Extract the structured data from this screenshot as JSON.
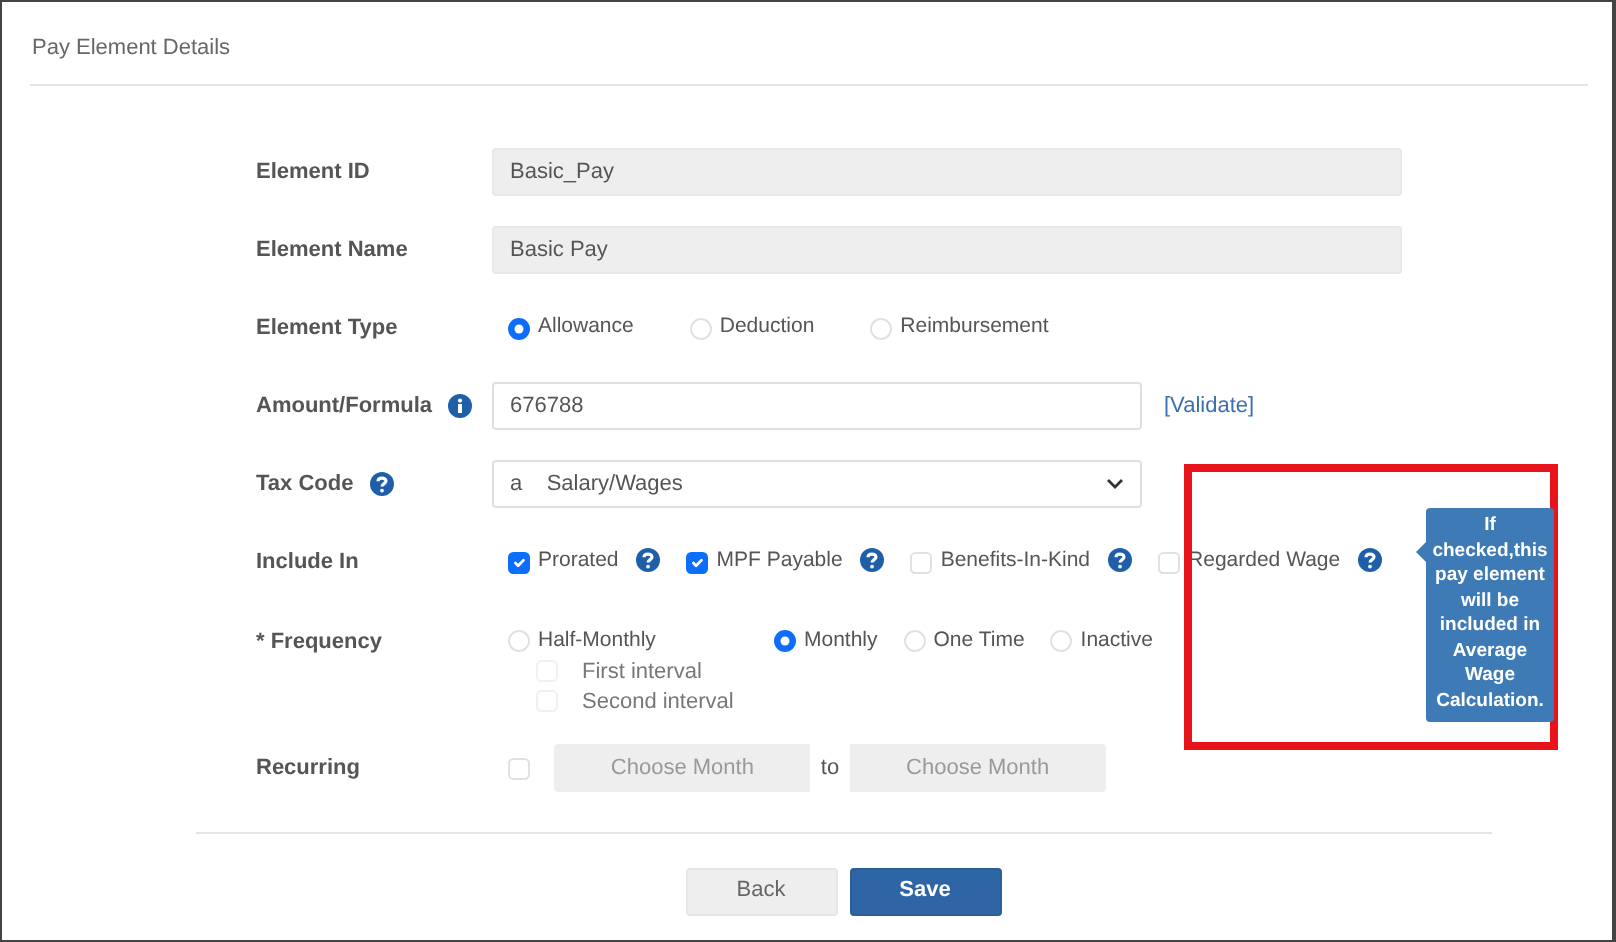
{
  "panel": {
    "title": "Pay Element Details"
  },
  "fields": [
    {
      "kind": "readonly",
      "label": "Element ID",
      "value": "Basic_Pay"
    },
    {
      "kind": "readonly",
      "label": "Element Name",
      "value": "Basic Pay"
    },
    {
      "kind": "radio",
      "label": "Element Type",
      "options": [
        {
          "label": "Allowance",
          "selected": true
        },
        {
          "label": "Deduction",
          "selected": false
        },
        {
          "label": "Reimbursement",
          "selected": false
        }
      ]
    },
    {
      "kind": "text",
      "label": "Amount/Formula",
      "info": true,
      "value": "676788",
      "link": "[Validate]"
    },
    {
      "kind": "select",
      "label": "Tax Code",
      "help": true,
      "value": "a    Salary/Wages"
    },
    {
      "kind": "checks",
      "label": "Include In",
      "options": [
        {
          "label": "Prorated",
          "checked": true,
          "help": true
        },
        {
          "label": "MPF Payable",
          "checked": true,
          "help": true
        },
        {
          "label": "Benefits-In-Kind",
          "checked": false,
          "help": true
        },
        {
          "label": "Regarded Wage",
          "checked": false,
          "help": true
        }
      ]
    },
    {
      "kind": "frequency",
      "label": "* Frequency",
      "options": [
        {
          "label": "Half-Monthly",
          "selected": false,
          "sub": [
            {
              "label": "First interval",
              "checked": false,
              "disabled": true
            },
            {
              "label": "Second interval",
              "checked": false,
              "disabled": true
            }
          ]
        },
        {
          "label": "Monthly",
          "selected": true
        },
        {
          "label": "One Time",
          "selected": false
        },
        {
          "label": "Inactive",
          "selected": false
        }
      ]
    },
    {
      "kind": "recurring",
      "label": "Recurring",
      "checked": false,
      "from": {
        "placeholder": "Choose Month"
      },
      "separator": "to",
      "to": {
        "placeholder": "Choose Month"
      }
    }
  ],
  "buttons": [
    {
      "label": "Back",
      "kind": "secondary"
    },
    {
      "label": "Save",
      "kind": "primary"
    }
  ],
  "tooltip": {
    "text": "If checked,this pay element will be included in Average Wage Calculation."
  }
}
